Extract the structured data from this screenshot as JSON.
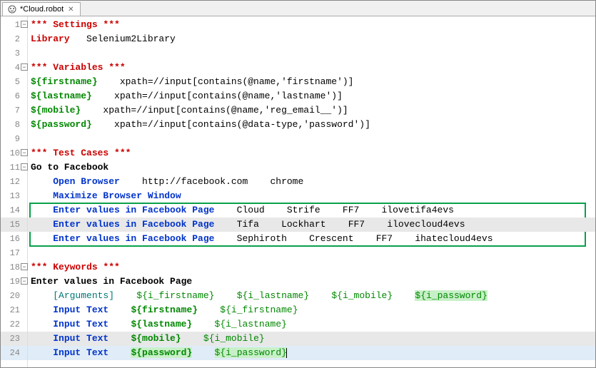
{
  "tab": {
    "title": "*Cloud.robot",
    "close_glyph": "✕"
  },
  "lines": {
    "l1": {
      "s1": "*** Settings ***"
    },
    "l2": {
      "s1": "Library",
      "s2": "   Selenium2Library"
    },
    "l3": {
      "s1": ""
    },
    "l4": {
      "s1": "*** Variables ***"
    },
    "l5": {
      "s1": "${firstname}",
      "s2": "    xpath=//input[contains(@name,'firstname')]"
    },
    "l6": {
      "s1": "${lastname}",
      "s2": "    xpath=//input[contains(@name,'lastname')]"
    },
    "l7": {
      "s1": "${mobile}",
      "s2": "    xpath=//input[contains(@name,'reg_email__')]"
    },
    "l8": {
      "s1": "${password}",
      "s2": "    xpath=//input[contains(@data-type,'password')]"
    },
    "l9": {
      "s1": ""
    },
    "l10": {
      "s1": "*** Test Cases ***"
    },
    "l11": {
      "s1": "Go to Facebook"
    },
    "l12": {
      "s1": "    ",
      "s2": "Open Browser",
      "s3": "    http://facebook.com    chrome"
    },
    "l13": {
      "s1": "    ",
      "s2": "Maximize Browser Window"
    },
    "l14": {
      "s1": "    ",
      "s2": "Enter values in Facebook Page",
      "s3": "    Cloud    Strife    FF7    ilovetifa4evs"
    },
    "l15": {
      "s1": "    ",
      "s2": "Enter values in Facebook Page",
      "s3": "    Tifa    Lockhart    FF7    ilovecloud4evs"
    },
    "l16": {
      "s1": "    ",
      "s2": "Enter values in Facebook Page",
      "s3": "    Sephiroth    Crescent    FF7    ihatecloud4evs"
    },
    "l17": {
      "s1": ""
    },
    "l18": {
      "s1": "*** Keywords ***"
    },
    "l19": {
      "s1": "Enter values in Facebook Page"
    },
    "l20": {
      "s1": "    ",
      "s2": "[Arguments]",
      "s3": "    ",
      "s4": "${i_firstname}",
      "s5": "    ",
      "s6": "${i_lastname}",
      "s7": "    ",
      "s8": "${i_mobile}",
      "s9": "    ",
      "s10": "${i_password}"
    },
    "l21": {
      "s1": "    ",
      "s2": "Input Text",
      "s3": "    ",
      "s4": "${firstname}",
      "s5": "    ",
      "s6": "${i_firstname}"
    },
    "l22": {
      "s1": "    ",
      "s2": "Input Text",
      "s3": "    ",
      "s4": "${lastname}",
      "s5": "    ",
      "s6": "${i_lastname}"
    },
    "l23": {
      "s1": "    ",
      "s2": "Input Text",
      "s3": "    ",
      "s4": "${mobile}",
      "s5": "    ",
      "s6": "${i_mobile}"
    },
    "l24": {
      "s1": "    ",
      "s2": "Input Text",
      "s3": "    ",
      "s4": "${password}",
      "s5": "    ",
      "s6": "${i_password}"
    }
  },
  "gutter": {
    "n1": "1",
    "n2": "2",
    "n3": "3",
    "n4": "4",
    "n5": "5",
    "n6": "6",
    "n7": "7",
    "n8": "8",
    "n9": "9",
    "n10": "10",
    "n11": "11",
    "n12": "12",
    "n13": "13",
    "n14": "14",
    "n15": "15",
    "n16": "16",
    "n17": "17",
    "n18": "18",
    "n19": "19",
    "n20": "20",
    "n21": "21",
    "n22": "22",
    "n23": "23",
    "n24": "24"
  }
}
